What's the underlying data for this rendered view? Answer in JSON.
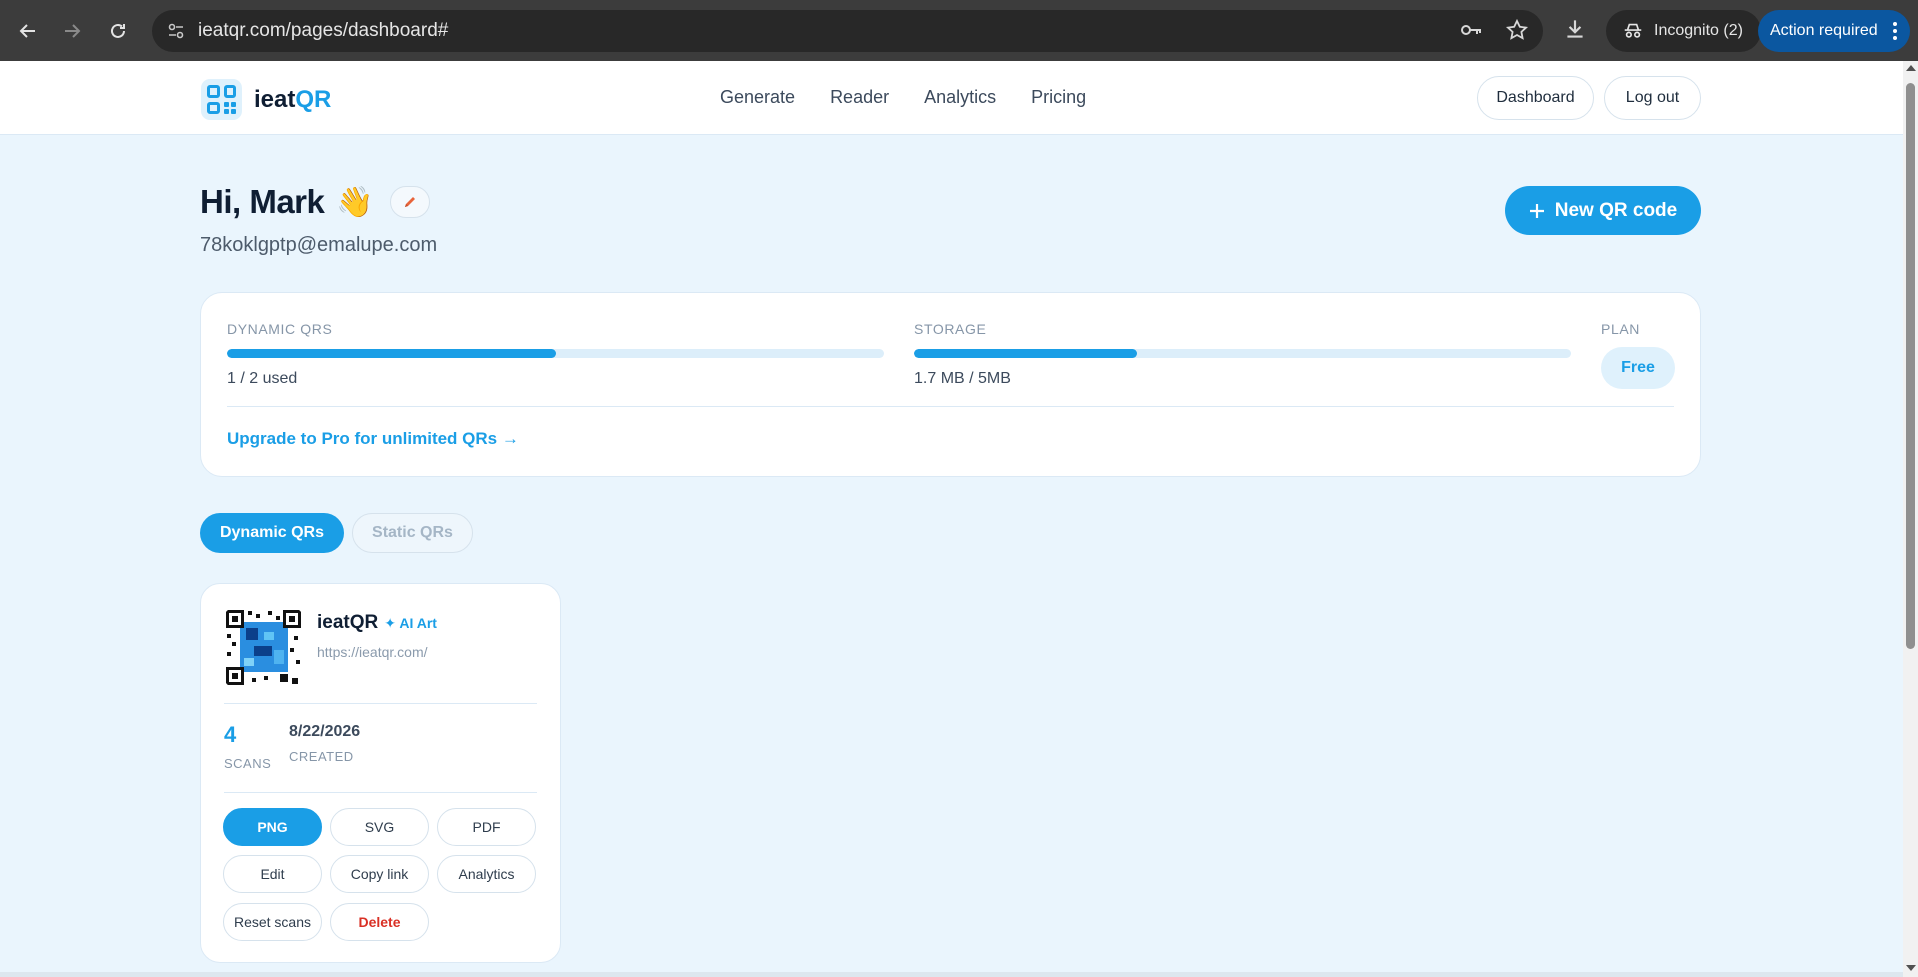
{
  "browser": {
    "url": "ieatqr.com/pages/dashboard#",
    "incognito_label": "Incognito (2)",
    "action_required_label": "Action required"
  },
  "site": {
    "logo_prefix": "ieat",
    "logo_suffix": "QR",
    "nav": [
      "Generate",
      "Reader",
      "Analytics",
      "Pricing"
    ],
    "dashboard_label": "Dashboard",
    "logout_label": "Log out"
  },
  "greeting": {
    "title": "Hi, Mark",
    "emoji": "👋",
    "email": "78koklgptp@emalupe.com",
    "new_qr_label": "New QR code"
  },
  "usage": {
    "dynamic_label": "DYNAMIC QRS",
    "dynamic_value": "1 / 2 used",
    "dynamic_fraction": 0.5,
    "storage_label": "STORAGE",
    "storage_value": "1.7 MB / 5MB",
    "storage_fraction": 0.34,
    "plan_label": "PLAN",
    "plan_value": "Free",
    "upgrade_link": "Upgrade to Pro for unlimited QRs →"
  },
  "tabs": {
    "dynamic": "Dynamic QRs",
    "static": "Static QRs"
  },
  "qr_card": {
    "name": "ieatQR",
    "tag": "✦ AI Art",
    "url": "https://ieatqr.com/",
    "scans": "4",
    "scans_label": "SCANS",
    "created": "8/22/2026",
    "created_label": "CREATED",
    "actions": {
      "png": "PNG",
      "svg": "SVG",
      "pdf": "PDF",
      "edit": "Edit",
      "copy_link": "Copy link",
      "analytics": "Analytics",
      "reset_scans": "Reset scans",
      "delete": "Delete"
    }
  },
  "colors": {
    "accent": "#1a9ee6",
    "background": "#eaf5fd",
    "danger": "#d93025"
  }
}
